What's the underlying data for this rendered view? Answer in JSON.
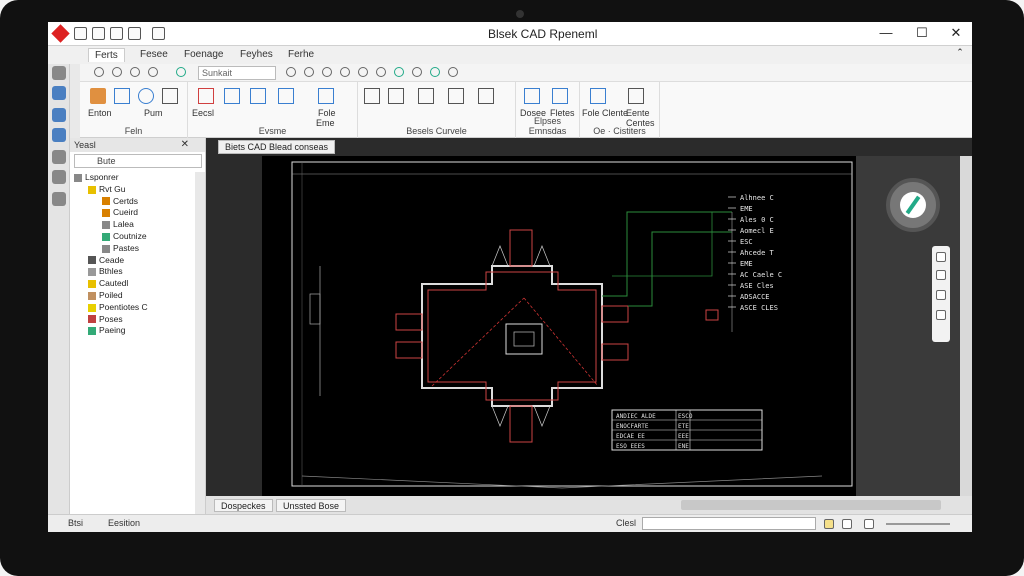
{
  "window": {
    "title": "Blsek CAD Rpeneml"
  },
  "ribbon_tabs": [
    "Ferts",
    "Fesee",
    "Foenage",
    "Feyhes",
    "Ferhe"
  ],
  "quick_access": {
    "combo_value": "Sunkait"
  },
  "ribbon_groups": [
    {
      "label": "Feln",
      "tools": [
        "Enton",
        "Pum"
      ]
    },
    {
      "label": "Evsme",
      "tools": [
        "Eecsl",
        "Fole",
        "Eme",
        "Flene"
      ]
    },
    {
      "label": "Besels Curvele",
      "tools": []
    },
    {
      "label": "Elpses Emnsdas",
      "tools": [
        "Dosee",
        "Fletes"
      ]
    },
    {
      "label": "Oe · Cistiters",
      "tools": [
        "Fole Clente",
        "Eente Centes"
      ]
    }
  ],
  "panel": {
    "title": "Yeasl",
    "search_value": "Bute",
    "tree": [
      {
        "label": "Lsponrer",
        "indent": 0,
        "color": "#888"
      },
      {
        "label": "Rvt Gu",
        "indent": 1,
        "color": "#e8c000"
      },
      {
        "label": "Certds",
        "indent": 2,
        "color": "#d88000"
      },
      {
        "label": "Cueird",
        "indent": 2,
        "color": "#d88000"
      },
      {
        "label": "Lalea",
        "indent": 2,
        "color": "#888"
      },
      {
        "label": "Coutnize",
        "indent": 2,
        "color": "#3a7"
      },
      {
        "label": "Pastes",
        "indent": 2,
        "color": "#888"
      },
      {
        "label": "Ceade",
        "indent": 1,
        "color": "#555"
      },
      {
        "label": "Bthles",
        "indent": 1,
        "color": "#999"
      },
      {
        "label": "Cautedl",
        "indent": 1,
        "color": "#e8c000"
      },
      {
        "label": "Poiled",
        "indent": 1,
        "color": "#c09060"
      },
      {
        "label": "Poentiotes C",
        "indent": 1,
        "color": "#e8d000"
      },
      {
        "label": "Poses",
        "indent": 1,
        "color": "#c04040"
      },
      {
        "label": "Paeing",
        "indent": 1,
        "color": "#3a7"
      }
    ]
  },
  "document_tab": "Biets CAD Blead conseas",
  "layout_tabs": [
    "Dospeckes",
    "Unssted Bose"
  ],
  "drawing": {
    "annotations": [
      "Alhnee C",
      "EME",
      "Ales 0 C",
      "Aomecl E",
      "ESC",
      "Ahcede T",
      "EME",
      "AC Caele C",
      "ASE Cles",
      "ADSACCE",
      "ASCE CLES"
    ],
    "title_block_rows": [
      [
        "ANDIEC ALDE",
        "ESCO"
      ],
      [
        "ENOCFARTE",
        "ETE"
      ],
      [
        "EDCAE EE",
        "EEE"
      ],
      [
        "ESO EEES",
        "ENE"
      ]
    ]
  },
  "status": {
    "left1": "Btsi",
    "left2": "Eesition",
    "command_label": "Clesl"
  }
}
